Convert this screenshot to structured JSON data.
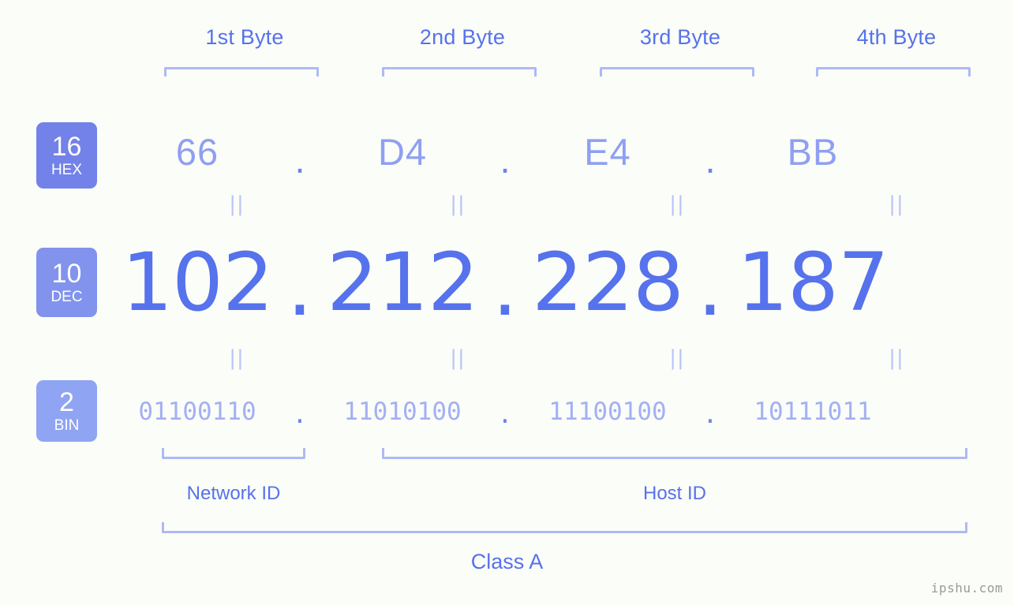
{
  "background": "#fbfdf8",
  "colors": {
    "primary": "#5672ec",
    "hex_value": "#8f9ff2",
    "bin_value": "#a3b0f4",
    "bracket": "#aeb9f7",
    "badge_hex": "#7382e8",
    "badge_dec": "#8293ee",
    "badge_bin": "#8fa4f2",
    "watermark": "#9a9a9a"
  },
  "byte_headers": [
    {
      "label": "1st Byte"
    },
    {
      "label": "2nd Byte"
    },
    {
      "label": "3rd Byte"
    },
    {
      "label": "4th Byte"
    }
  ],
  "badges": {
    "hex": {
      "number": "16",
      "name": "HEX"
    },
    "dec": {
      "number": "10",
      "name": "DEC"
    },
    "bin": {
      "number": "2",
      "name": "BIN"
    }
  },
  "rows": {
    "hex": {
      "values": [
        "66",
        "D4",
        "E4",
        "BB"
      ],
      "separator": "."
    },
    "dec": {
      "values": [
        "102",
        "212",
        "228",
        "187"
      ],
      "separator": "."
    },
    "bin": {
      "values": [
        "01100110",
        "11010100",
        "11100100",
        "10111011"
      ],
      "separator": "."
    }
  },
  "equals_marks": {
    "symbol": "||"
  },
  "sections": {
    "network_id": "Network ID",
    "host_id": "Host ID",
    "class": "Class A"
  },
  "watermark": "ipshu.com"
}
